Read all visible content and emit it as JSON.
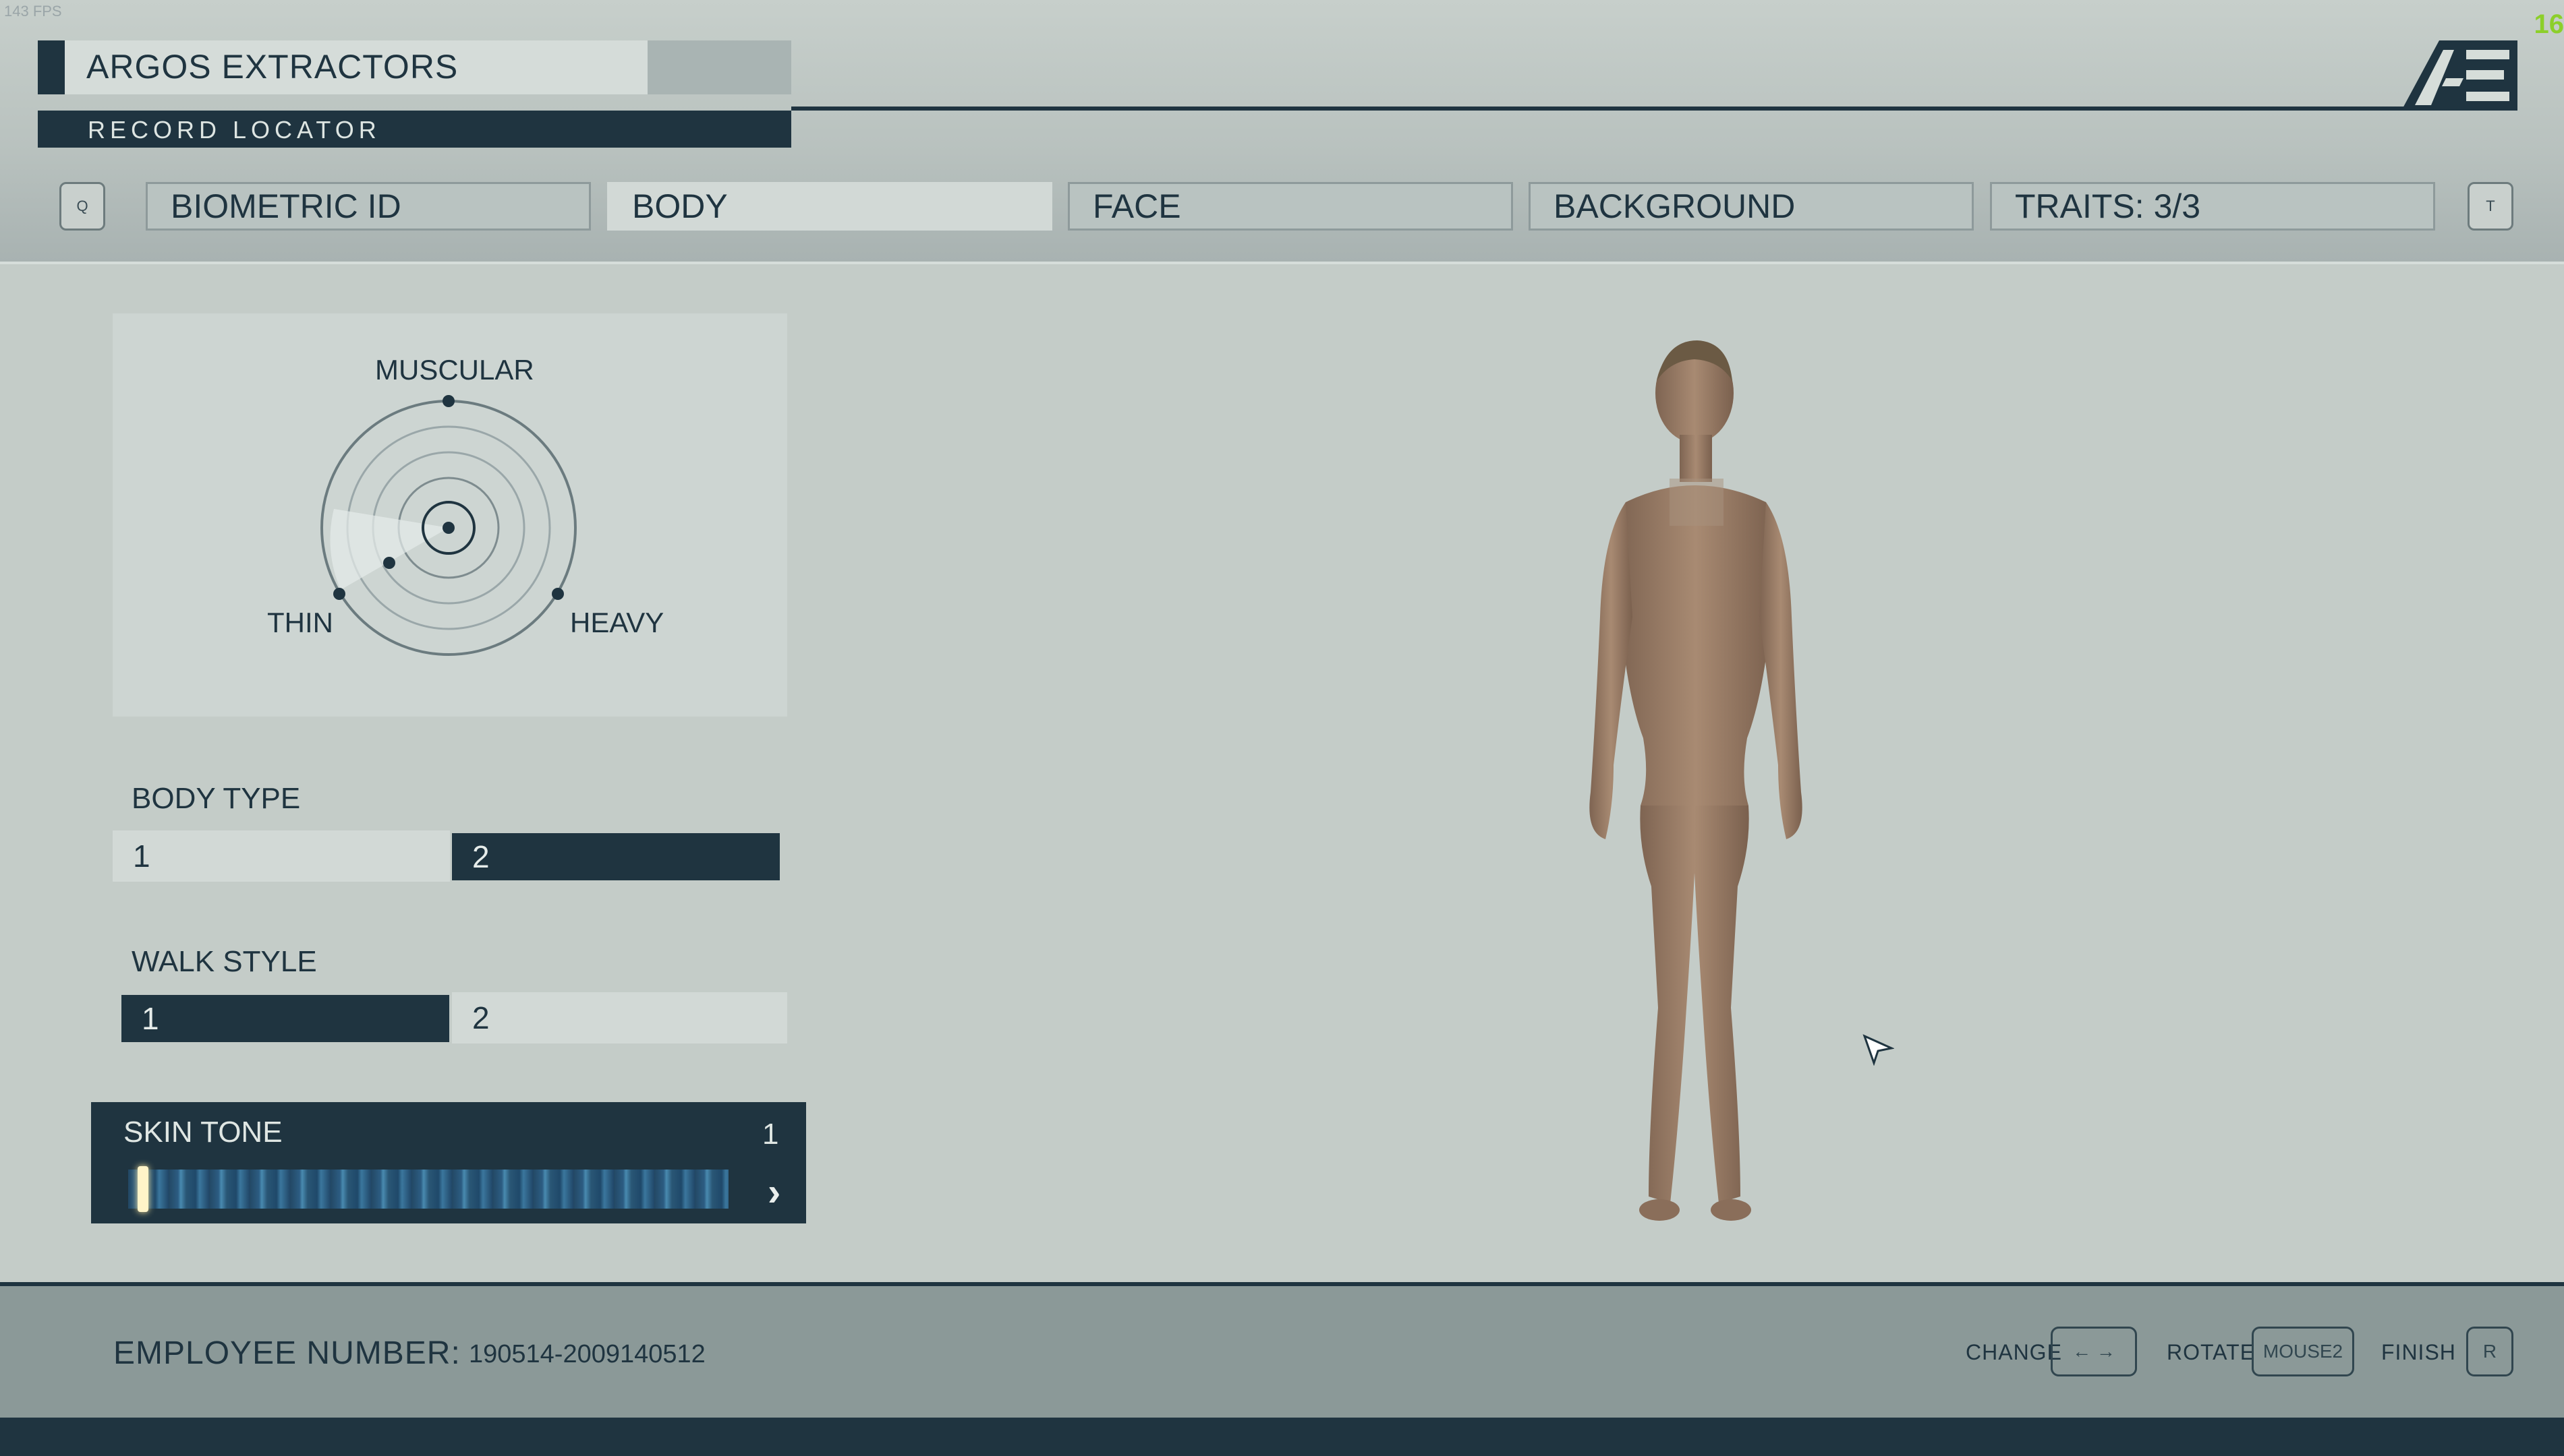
{
  "overlay": {
    "fps": "143 FPS",
    "corner_number": "16"
  },
  "header": {
    "company": "ARGOS EXTRACTORS",
    "record_locator": "RECORD LOCATOR",
    "logo_icon": "ae-logo-icon",
    "left_key": "Q",
    "right_key": "T",
    "tabs": [
      {
        "label": "BIOMETRIC ID",
        "active": false
      },
      {
        "label": "BODY",
        "active": true
      },
      {
        "label": "FACE",
        "active": false
      },
      {
        "label": "BACKGROUND",
        "active": false
      },
      {
        "label": "TRAITS: 3/3",
        "active": false
      }
    ]
  },
  "body_shape": {
    "muscular_label": "MUSCULAR",
    "thin_label": "THIN",
    "heavy_label": "HEAVY"
  },
  "body_type": {
    "title": "BODY TYPE",
    "options": [
      "1",
      "2"
    ],
    "selected": "2"
  },
  "walk_style": {
    "title": "WALK STYLE",
    "options": [
      "1",
      "2"
    ],
    "selected": "1"
  },
  "skin_tone": {
    "title": "SKIN TONE",
    "value": "1",
    "arrow_icon": "chevron-right-icon"
  },
  "footer": {
    "employee_label": "EMPLOYEE NUMBER:",
    "employee_number": "190514-2009140512",
    "change_label": "CHANGE",
    "change_key": "← →",
    "rotate_label": "ROTATE",
    "rotate_key": "MOUSE2",
    "finish_label": "FINISH",
    "finish_key": "R"
  },
  "colors": {
    "dark_navy": "#1f3440",
    "panel_light": "#cdd5d2",
    "background": "#c4ccc8",
    "footer": "#8b9998"
  }
}
